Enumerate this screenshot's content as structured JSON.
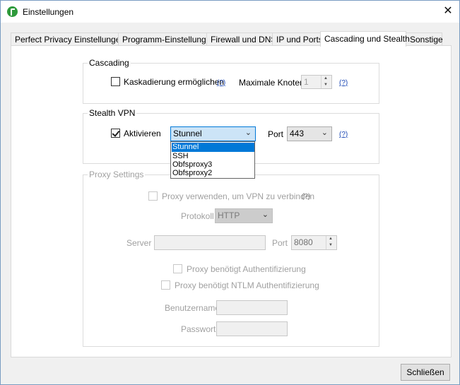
{
  "window": {
    "title": "Einstellungen",
    "close_symbol": "✕"
  },
  "tabs": [
    {
      "label": "Perfect Privacy Einstellungen"
    },
    {
      "label": "Programm-Einstellungen"
    },
    {
      "label": "Firewall und DNS"
    },
    {
      "label": "IP und Ports"
    },
    {
      "label": "Cascading und Stealth"
    },
    {
      "label": "Sonstige"
    }
  ],
  "active_tab": "Cascading und Stealth",
  "cascading": {
    "title": "Cascading",
    "enable_label": "Kaskadierung ermöglichen",
    "enable_checked": false,
    "help": "(?)",
    "max_nodes_label": "Maximale Knoten",
    "max_nodes_value": "1",
    "max_help": "(?)"
  },
  "stealth": {
    "title": "Stealth VPN",
    "activate_label": "Aktivieren",
    "activate_checked": true,
    "method_value": "Stunnel",
    "port_label": "Port",
    "port_value": "443",
    "help": "(?)",
    "dropdown_options": [
      "Stunnel",
      "SSH",
      "Obfsproxy3",
      "Obfsproxy2"
    ],
    "dropdown_selected": "Stunnel"
  },
  "proxy": {
    "title": "Proxy Settings",
    "use_label": "Proxy verwenden, um VPN zu verbinden",
    "use_help": "(?)",
    "protocol_label": "Protokoll",
    "protocol_value": "HTTP",
    "server_label": "Server",
    "server_value": "",
    "port_label": "Port",
    "port_value": "8080",
    "auth_label": "Proxy benötigt Authentifizierung",
    "ntlm_label": "Proxy benötigt NTLM Authentifizierung",
    "username_label": "Benutzername",
    "username_value": "",
    "password_label": "Passwort",
    "password_value": ""
  },
  "footer": {
    "close_label": "Schließen"
  },
  "colors": {
    "accent": "#0078d7",
    "link": "#1a47b5",
    "disabled": "#a0a0a0"
  }
}
